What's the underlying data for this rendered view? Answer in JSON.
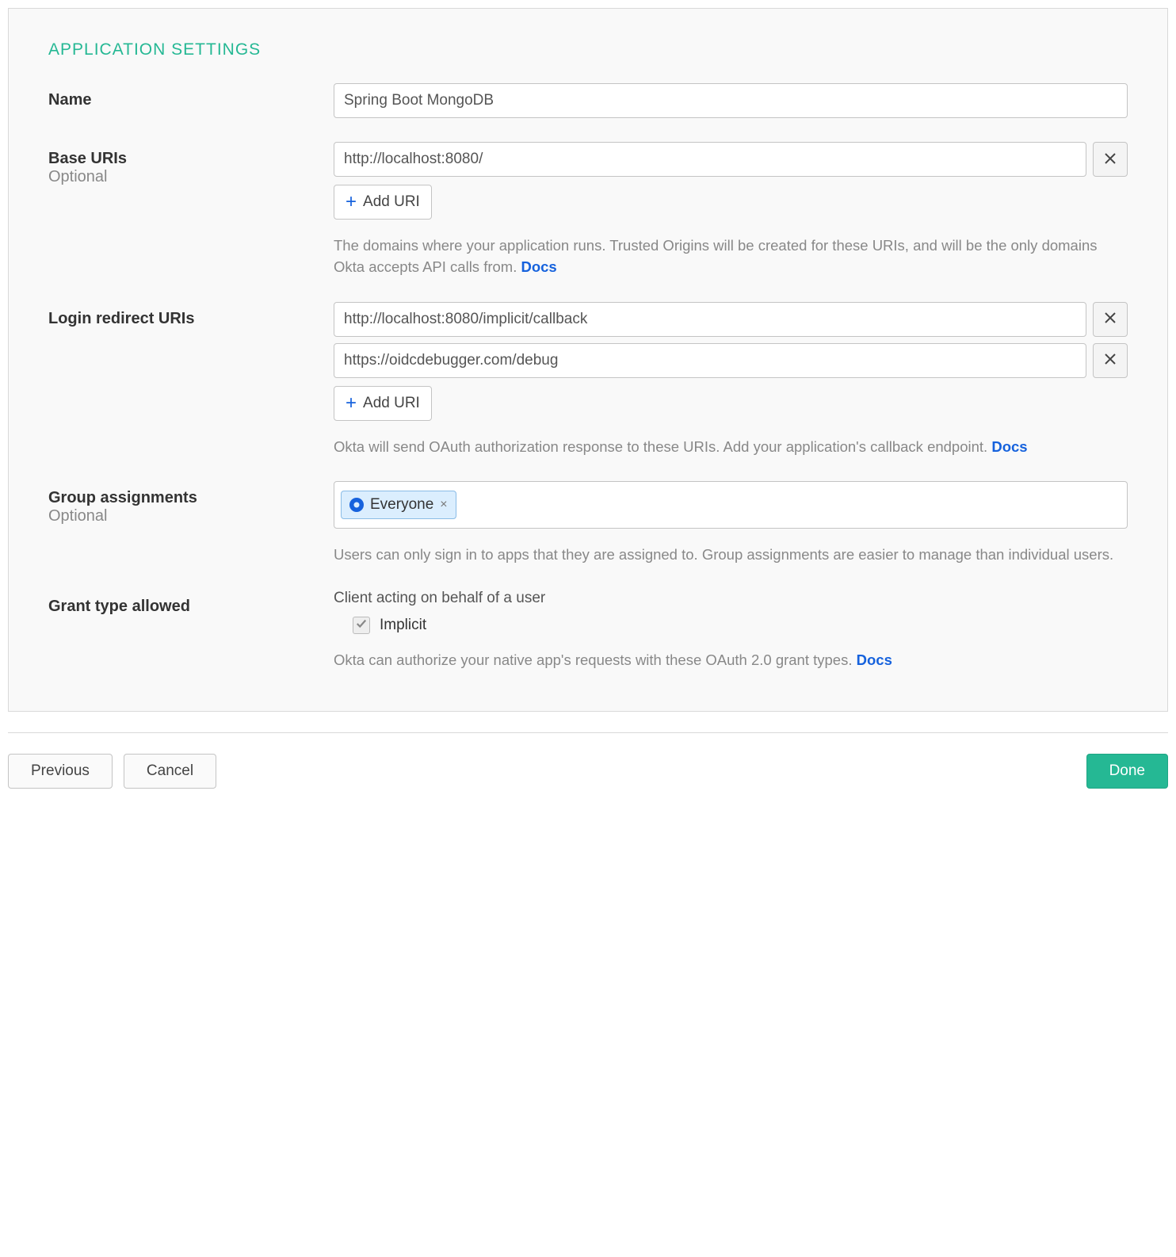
{
  "panel": {
    "title": "APPLICATION SETTINGS"
  },
  "fields": {
    "name": {
      "label": "Name",
      "value": "Spring Boot MongoDB"
    },
    "baseUris": {
      "label": "Base URIs",
      "sub": "Optional",
      "values": [
        "http://localhost:8080/"
      ],
      "addLabel": "Add URI",
      "help": "The domains where your application runs. Trusted Origins will be created for these URIs, and will be the only domains Okta accepts API calls from. ",
      "docsLabel": "Docs"
    },
    "loginRedirect": {
      "label": "Login redirect URIs",
      "values": [
        "http://localhost:8080/implicit/callback",
        "https://oidcdebugger.com/debug"
      ],
      "addLabel": "Add URI",
      "help": "Okta will send OAuth authorization response to these URIs. Add your application's callback endpoint. ",
      "docsLabel": "Docs"
    },
    "groupAssignments": {
      "label": "Group assignments",
      "sub": "Optional",
      "tags": [
        "Everyone"
      ],
      "help": "Users can only sign in to apps that they are assigned to. Group assignments are easier to manage than individual users."
    },
    "grantType": {
      "label": "Grant type allowed",
      "subheading": "Client acting on behalf of a user",
      "options": [
        {
          "label": "Implicit",
          "checked": true,
          "disabled": true
        }
      ],
      "help": "Okta can authorize your native app's requests with these OAuth 2.0 grant types. ",
      "docsLabel": "Docs"
    }
  },
  "footer": {
    "previous": "Previous",
    "cancel": "Cancel",
    "done": "Done"
  }
}
